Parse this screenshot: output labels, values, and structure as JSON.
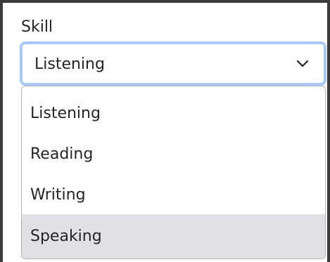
{
  "field": {
    "label": "Skill",
    "selected_value": "Listening",
    "options": [
      {
        "label": "Listening"
      },
      {
        "label": "Reading"
      },
      {
        "label": "Writing"
      },
      {
        "label": "Speaking"
      }
    ],
    "highlighted_option": "Speaking"
  },
  "icons": {
    "dropdown_indicator": "chevron-down-icon"
  },
  "colors": {
    "focus_ring": "#a8c9f5",
    "highlight_background": "#e1e0e6",
    "text": "#212529"
  }
}
